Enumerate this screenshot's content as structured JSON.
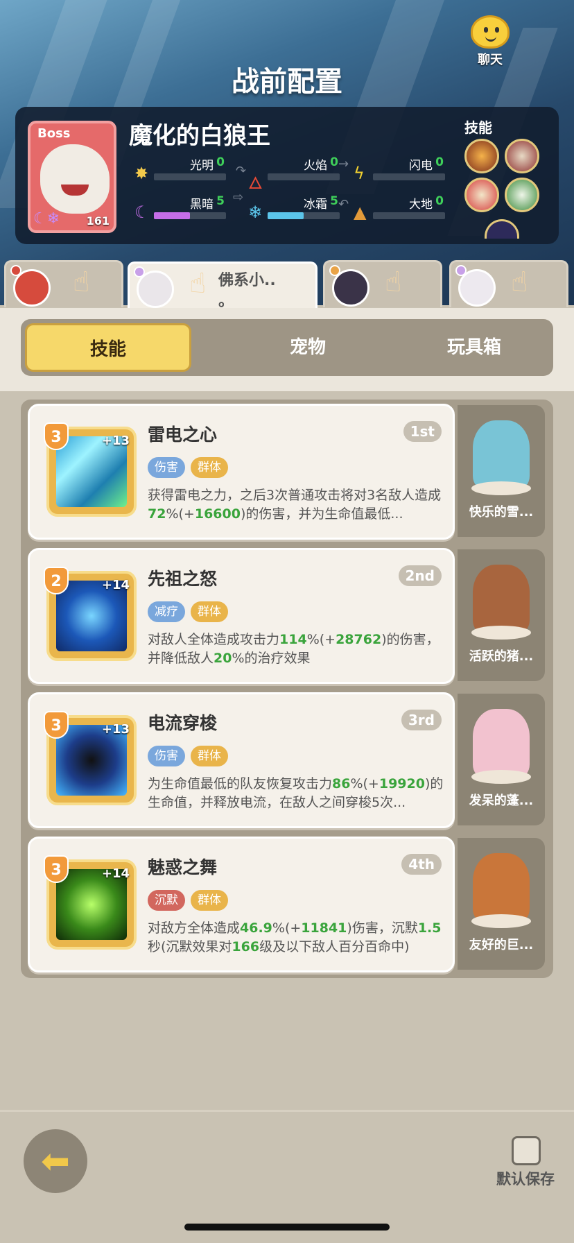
{
  "header": {
    "title": "战前配置",
    "chat_label": "聊天"
  },
  "boss": {
    "tag": "Boss",
    "name": "魔化的白狼王",
    "level": "161",
    "skills_label": "技能",
    "elements": [
      {
        "name": "光明",
        "value": "0",
        "icon": "sun-icon",
        "color": "#f3c94b",
        "fill": 0
      },
      {
        "name": "火焰",
        "value": "0",
        "icon": "flame-icon",
        "color": "#e84a36",
        "fill": 0
      },
      {
        "name": "闪电",
        "value": "0",
        "icon": "lightning-icon",
        "color": "#f2d130",
        "fill": 0
      },
      {
        "name": "黑暗",
        "value": "5",
        "icon": "moon-icon",
        "color": "#c56ee8",
        "fill": 5
      },
      {
        "name": "冰霜",
        "value": "5",
        "icon": "snowflake-icon",
        "color": "#5bc5ea",
        "fill": 5
      },
      {
        "name": "大地",
        "value": "0",
        "icon": "mountain-icon",
        "color": "#e29a3a",
        "fill": 0
      }
    ]
  },
  "characters": [
    {
      "name": "",
      "avatar_color": "#d64b3d"
    },
    {
      "name": "佛系小..",
      "name2": "。",
      "avatar_color": "#eae6ea"
    },
    {
      "name": "",
      "avatar_color": "#3a3348"
    },
    {
      "name": "",
      "avatar_color": "#ede9ef"
    }
  ],
  "tabs": {
    "skills": "技能",
    "pets": "宠物",
    "toybox": "玩具箱",
    "active": "skills"
  },
  "skills": [
    {
      "title": "雷电之心",
      "rank": "1st",
      "level": "3",
      "plus": "+13",
      "tags": [
        {
          "text": "伤害",
          "color": "blue"
        },
        {
          "text": "群体",
          "color": "orange"
        }
      ],
      "desc_parts": [
        "获得雷电之力，之后3次普通攻击将对3名敌人造成",
        "72",
        "%(+",
        "16600",
        ")的伤害，并为生命值最低..."
      ],
      "pet": "快乐的雪..."
    },
    {
      "title": "先祖之怒",
      "rank": "2nd",
      "level": "2",
      "plus": "+14",
      "tags": [
        {
          "text": "减疗",
          "color": "blue"
        },
        {
          "text": "群体",
          "color": "orange"
        }
      ],
      "desc_parts": [
        "对敌人全体造成攻击力",
        "114",
        "%(+",
        "28762",
        ")的伤害，并降低敌人",
        "20",
        "%的治疗效果"
      ],
      "pet": "活跃的猪..."
    },
    {
      "title": "电流穿梭",
      "rank": "3rd",
      "level": "3",
      "plus": "+13",
      "tags": [
        {
          "text": "伤害",
          "color": "blue"
        },
        {
          "text": "群体",
          "color": "orange"
        }
      ],
      "desc_parts": [
        "为生命值最低的队友恢复攻击力",
        "86",
        "%(+",
        "19920",
        ")的生命值，并释放电流，在敌人之间穿梭5次..."
      ],
      "pet": "发呆的蓬..."
    },
    {
      "title": "魅惑之舞",
      "rank": "4th",
      "level": "3",
      "plus": "+14",
      "tags": [
        {
          "text": "沉默",
          "color": "red"
        },
        {
          "text": "群体",
          "color": "orange"
        }
      ],
      "desc_parts": [
        "对敌方全体造成",
        "46.9",
        "%(+",
        "11841",
        ")伤害，沉默",
        "1.5",
        "秒(沉默效果对",
        "166",
        "级及以下敌人百分百命中)"
      ],
      "pet": "友好的巨..."
    }
  ],
  "footer": {
    "save_label": "默认保存"
  }
}
